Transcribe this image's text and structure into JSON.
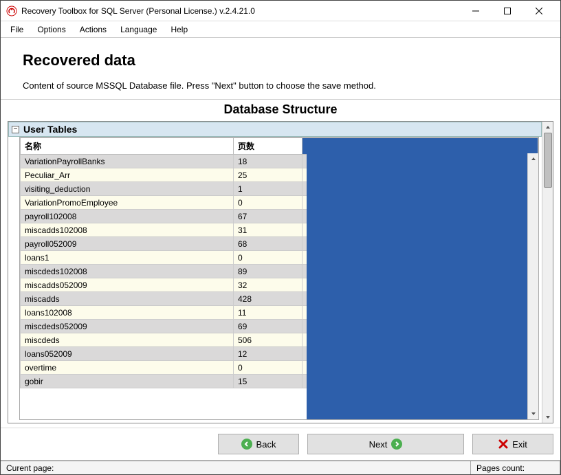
{
  "window": {
    "title": "Recovery Toolbox for SQL Server (Personal License.) v.2.4.21.0"
  },
  "menubar": {
    "file": "File",
    "options": "Options",
    "actions": "Actions",
    "language": "Language",
    "help": "Help"
  },
  "header": {
    "title": "Recovered data",
    "description": "Content of source MSSQL Database file. Press \"Next\" button to choose the save method.",
    "section_title": "Database Structure"
  },
  "tree": {
    "group_label": "User Tables",
    "columns": {
      "name": "名称",
      "pages": "页数"
    },
    "rows": [
      {
        "name": "VariationPayrollBanks",
        "pages": "18"
      },
      {
        "name": "Peculiar_Arr",
        "pages": "25"
      },
      {
        "name": "visiting_deduction",
        "pages": "1"
      },
      {
        "name": "VariationPromoEmployee",
        "pages": "0"
      },
      {
        "name": "payroll102008",
        "pages": "67"
      },
      {
        "name": "miscadds102008",
        "pages": "31"
      },
      {
        "name": "payroll052009",
        "pages": "68"
      },
      {
        "name": "loans1",
        "pages": "0"
      },
      {
        "name": "miscdeds102008",
        "pages": "89"
      },
      {
        "name": "miscadds052009",
        "pages": "32"
      },
      {
        "name": "miscadds",
        "pages": "428"
      },
      {
        "name": "loans102008",
        "pages": "11"
      },
      {
        "name": "miscdeds052009",
        "pages": "69"
      },
      {
        "name": "miscdeds",
        "pages": "506"
      },
      {
        "name": "loans052009",
        "pages": "12"
      },
      {
        "name": "overtime",
        "pages": "0"
      },
      {
        "name": "gobir",
        "pages": "15"
      }
    ]
  },
  "buttons": {
    "back": "Back",
    "next": "Next",
    "exit": "Exit"
  },
  "statusbar": {
    "current_page": "Curent page:",
    "pages_count": "Pages count:"
  }
}
